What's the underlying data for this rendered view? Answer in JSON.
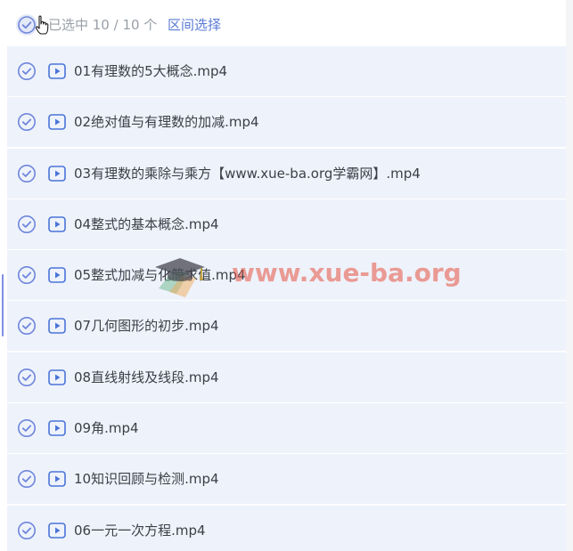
{
  "header": {
    "selected_count": "已选中 10 / 10 个",
    "range_select": "区间选择"
  },
  "files": [
    {
      "name": "01有理数的5大概念.mp4"
    },
    {
      "name": "02绝对值与有理数的加减.mp4"
    },
    {
      "name": "03有理数的乘除与乘方【www.xue-ba.org学霸网】.mp4"
    },
    {
      "name": "04整式的基本概念.mp4"
    },
    {
      "name": "05整式加减与化简求值.mp4"
    },
    {
      "name": "07几何图形的初步.mp4"
    },
    {
      "name": "08直线射线及线段.mp4"
    },
    {
      "name": "09角.mp4"
    },
    {
      "name": "10知识回顾与检测.mp4"
    },
    {
      "name": "06一元一次方程.mp4"
    }
  ],
  "watermark": {
    "text": "www.xue-ba.org"
  },
  "colors": {
    "accent": "#5b7bd6",
    "row_bg": "#eef2fb",
    "check": "#6f86dc"
  }
}
